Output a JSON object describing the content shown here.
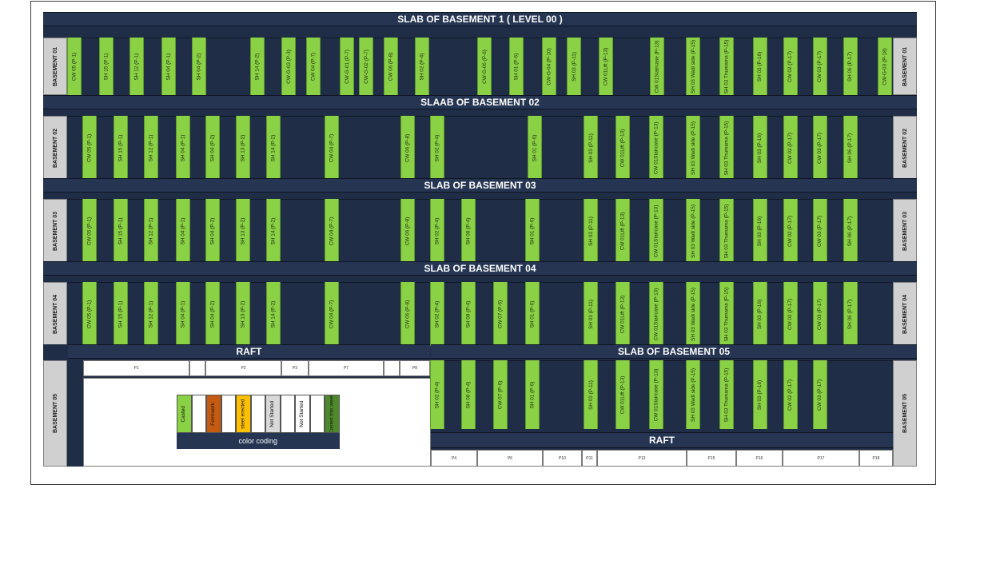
{
  "rows": [
    {
      "title": "SLAB OF BASEMENT 1 ( LEVEL 00 )",
      "side_label": "BASEMENT 01",
      "columns": [
        "CW 05 (P-1)",
        "SH 15 (P-1)",
        "SH 12 (P-1)",
        "SH 04 (P-1)",
        "SH 04 (P-2)",
        "SH 14 (P-2)",
        "CW-G-03 (P-3)",
        "CW 04 (P-7)",
        "CW-G-01 (P-7)",
        "CW-G-02 (P-7)",
        "CW 06 (P-8)",
        "SH 02 (P-4)",
        "CW-G-06 (P-6)",
        "SH 01 (P-6)",
        "CW-G-04 (P-10)",
        "SH 03 (P-11)",
        "CW 01Lift (P-13)",
        "CW 01Staircase (P-13)",
        "SH 03 Wadi side (P-15)",
        "SH 03 Thumama (P-15)",
        "SH 03 (P-16)",
        "CW 02 (P-17)",
        "CW 03 (P-17)",
        "SH 06 (P-17)",
        "CW-G-03 (P-18)"
      ]
    },
    {
      "title": "SLAAB OF BASEMENT 02",
      "side_label": "BASEMENT 02",
      "columns": [
        "CW 05 (P-1)",
        "SH 15 (P-1)",
        "SH 12 (P-1)",
        "SH 04 (P-1)",
        "SH 04 (P-2)",
        "SH 13 (P-2)",
        "SH 14 (P-2)",
        "CW 04 (P-7)",
        "CW 06 (P-8)",
        "SH 02 (P-4)",
        "SH 01 (P-6)",
        "SH 03 (P-11)",
        "CW 01Lift (P-13)",
        "CW 01Staircase (P-13)",
        "SH 03 Wadi side (P-15)",
        "SH 03 Thumama (P-15)",
        "SH 03 (P-16)",
        "CW 02 (P-17)",
        "CW 03 (P-17)",
        "SH 06 (P-17)"
      ]
    },
    {
      "title": "SLAB OF BASEMENT 03",
      "side_label": "BASEMENT 03",
      "columns": [
        "CW 05 (P-1)",
        "SH 15 (P-1)",
        "SH 12 (P-1)",
        "SH 04 (P-1)",
        "SH 04 (P-2)",
        "SH 13 (P-2)",
        "SH 14 (P-2)",
        "CW 04 (P-7)",
        "CW 06 (P-8)",
        "SH 02 (P-4)",
        "SH 08 (P-4)",
        "SH 01 (P-6)",
        "SH 03 (P-11)",
        "CW 01Lift (P-13)",
        "CW 01Staircase (P-13)",
        "SH 03 Wadi side (P-15)",
        "SH 03 Thumama (P-15)",
        "SH 03 (P-16)",
        "CW 02 (P-17)",
        "CW 03 (P-17)",
        "SH 06 (P-17)"
      ]
    },
    {
      "title": "SLAB OF BASEMENT 04",
      "side_label": "BASEMENT 04",
      "columns": [
        "CW 05 (P-1)",
        "SH 15 (P-1)",
        "SH 12 (P-1)",
        "SH 04 (P-1)",
        "SH 04 (P-2)",
        "SH 13 (P-2)",
        "SH 14 (P-2)",
        "CW 04 (P-7)",
        "CW 06 (P-8)",
        "SH 02 (P-4)",
        "SH 08 (P-4)",
        "CW 07 (P-6)",
        "SH 01 (P-6)",
        "SH 03 (P-11)",
        "CW 01Lift (P-13)",
        "CW 01Staircase (P-13)",
        "SH 03 Wadi side (P-15)",
        "SH 03 Thumama (P-15)",
        "SH 03 (P-16)",
        "CW 02 (P-17)",
        "CW 03 (P-17)",
        "SH 06 (P-17)"
      ]
    }
  ],
  "basement05": {
    "side_label": "BASEMENT 05",
    "left_raft_title": "RAFT",
    "left_raft_cells": [
      "P1",
      "",
      "P2",
      "P3",
      "P7",
      "",
      "P8"
    ],
    "right_title": "SLAB OF BASEMENT 05",
    "right_columns": [
      "SH 02 (P-4)",
      "SH 08 (P-4)",
      "CW 07 (P-6)",
      "SH 01 (P-6)",
      "SH 03 (P-11)",
      "CW 01Lift (P-13)",
      "CW 01Staircase (P-13)",
      "SH 03 Wadi side (P-15)",
      "SH 03 Thumama (P-15)",
      "SH 03 (P-16)",
      "CW 02 (P-17)",
      "CW 03 (P-17)"
    ],
    "right_raft_title": "RAFT",
    "right_raft_cells": [
      "P4",
      "P6",
      "P10",
      "P11",
      "P13",
      "P15",
      "P16",
      "P17",
      "P18"
    ]
  },
  "legend": {
    "title": "color coding",
    "items": [
      {
        "label": "Casted",
        "color": "#8bd145"
      },
      {
        "label": "",
        "color": "#ffffff"
      },
      {
        "label": "Formwork",
        "color": "#c55a11"
      },
      {
        "label": "",
        "color": "#ffffff"
      },
      {
        "label": "steel erected",
        "color": "#ffc000"
      },
      {
        "label": "",
        "color": "#ffffff"
      },
      {
        "label": "Not Started",
        "color": "#d9d9d9"
      },
      {
        "label": "",
        "color": "#ffffff"
      },
      {
        "label": "Not Started",
        "color": "#ffffff"
      },
      {
        "label": "",
        "color": "#ffffff"
      },
      {
        "label": "Casted this week",
        "color": "#4e8a2c"
      }
    ]
  }
}
